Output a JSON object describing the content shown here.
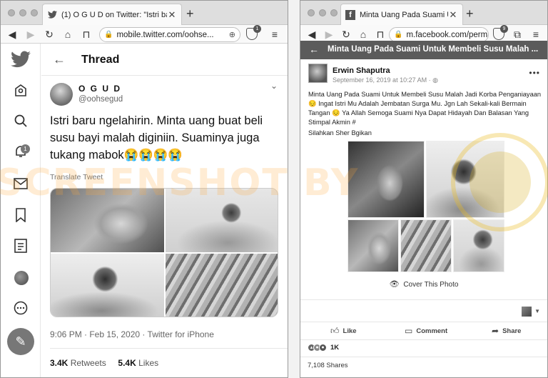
{
  "twitter_window": {
    "tab_title": "(1) O G U D on Twitter: \"Istri baru ...",
    "url": "mobile.twitter.com/oohse...",
    "shield_count": "1",
    "notification_count": "1",
    "header_title": "Thread",
    "tweet": {
      "display_name": "O G U D",
      "handle": "@oohsegud",
      "text": "Istri baru ngelahirin. Minta uang buat beli susu bayi malah diginiin. Suaminya juga tukang mabok😭😭😭😭",
      "translate_label": "Translate Tweet",
      "timestamp": "9:06 PM · Feb 15, 2020 · Twitter for iPhone",
      "retweets": "3.4K",
      "retweets_label": "Retweets",
      "likes": "5.4K",
      "likes_label": "Likes"
    }
  },
  "facebook_window": {
    "tab_title": "Minta Uang Pada Suami Untuk Me...",
    "url": "m.facebook.com/perma...",
    "shield_count": "9",
    "header_title": "Minta Uang Pada Suami Untuk Membeli Susu Malah ...",
    "post": {
      "author": "Erwin Shaputra",
      "date": "September 16, 2019 at 10:27 AM · ",
      "text": "Minta Uang Pada Suami Untuk Membeli Susu Malah Jadi Korba Penganiayaan 😔 Ingat Istri Mu Adalah Jembatan Surga Mu. Jgn Lah Sekali-kali Bermain Tangan 😔 Ya Allah Semoga Suami Nya Dapat Hidayah Dan Balasan Yang Stimpal Akmin #",
      "share_line": "Silahkan Sher Bgikan",
      "cover_label": "Cover This Photo",
      "like_label": "Like",
      "comment_label": "Comment",
      "share_label": "Share",
      "reactions_count": "1K",
      "shares_text": "7,108 Shares"
    }
  },
  "watermark": {
    "text": "SCREENSHOT BY",
    "seal_text": "TURN BACK HOAX"
  },
  "colors": {
    "watermark": "#ffaa3c",
    "seal": "#ebbe28"
  }
}
